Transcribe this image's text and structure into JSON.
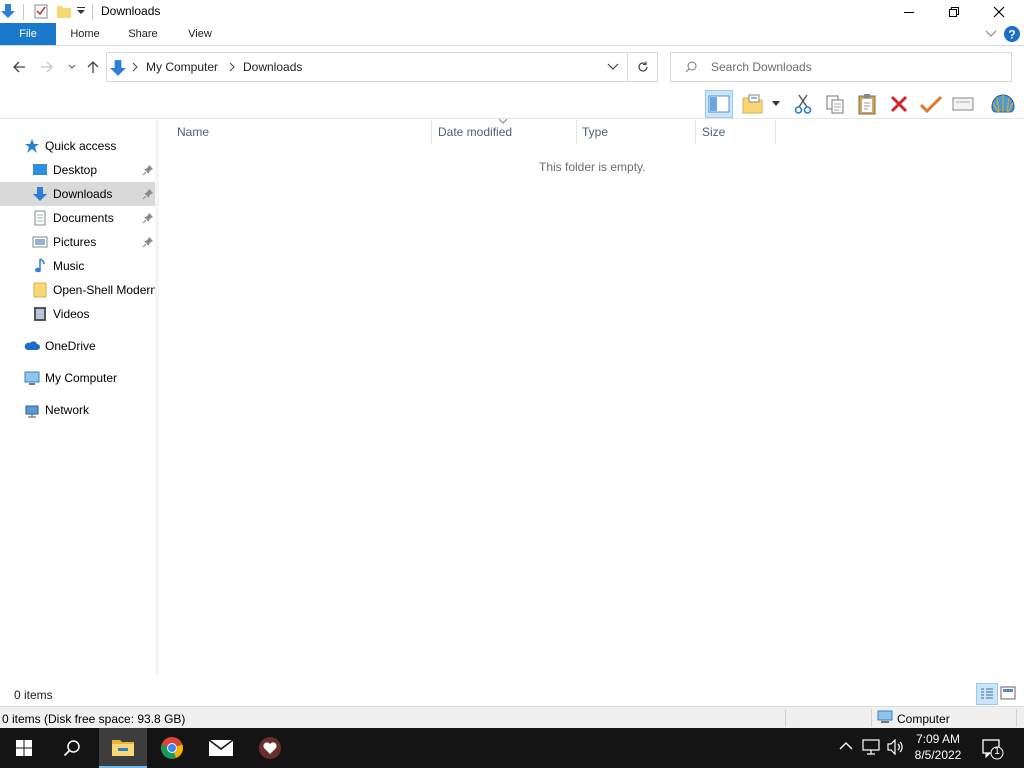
{
  "window": {
    "title": "Downloads"
  },
  "ribbon": {
    "tabs": [
      {
        "label": "File"
      },
      {
        "label": "Home"
      },
      {
        "label": "Share"
      },
      {
        "label": "View"
      }
    ]
  },
  "address": {
    "crumbs": [
      "My Computer",
      "Downloads"
    ]
  },
  "search": {
    "placeholder": "Search Downloads"
  },
  "nav": {
    "quick_access": "Quick access",
    "items": [
      {
        "label": "Desktop",
        "icon": "desktop-icon",
        "pinned": true
      },
      {
        "label": "Downloads",
        "icon": "downloads-icon",
        "pinned": true,
        "selected": true
      },
      {
        "label": "Documents",
        "icon": "documents-icon",
        "pinned": true
      },
      {
        "label": "Pictures",
        "icon": "pictures-icon",
        "pinned": true
      },
      {
        "label": "Music",
        "icon": "music-icon",
        "pinned": false
      },
      {
        "label": "Open-Shell Modern",
        "icon": "folder-icon",
        "pinned": false
      },
      {
        "label": "Videos",
        "icon": "videos-icon",
        "pinned": false
      }
    ],
    "onedrive": "OneDrive",
    "my_computer": "My Computer",
    "network": "Network"
  },
  "columns": [
    "Name",
    "Date modified",
    "Type",
    "Size"
  ],
  "content": {
    "empty_message": "This folder is empty."
  },
  "items_bar": {
    "count": "0 items"
  },
  "status_bar": {
    "text": "0 items (Disk free space: 93.8 GB)",
    "location": "Computer"
  },
  "taskbar": {
    "time": "7:09 AM",
    "date": "8/5/2022",
    "notification_count": "1"
  },
  "colors": {
    "accent": "#1979ca",
    "selection": "#d9d9d9",
    "taskbar": "#141414"
  }
}
